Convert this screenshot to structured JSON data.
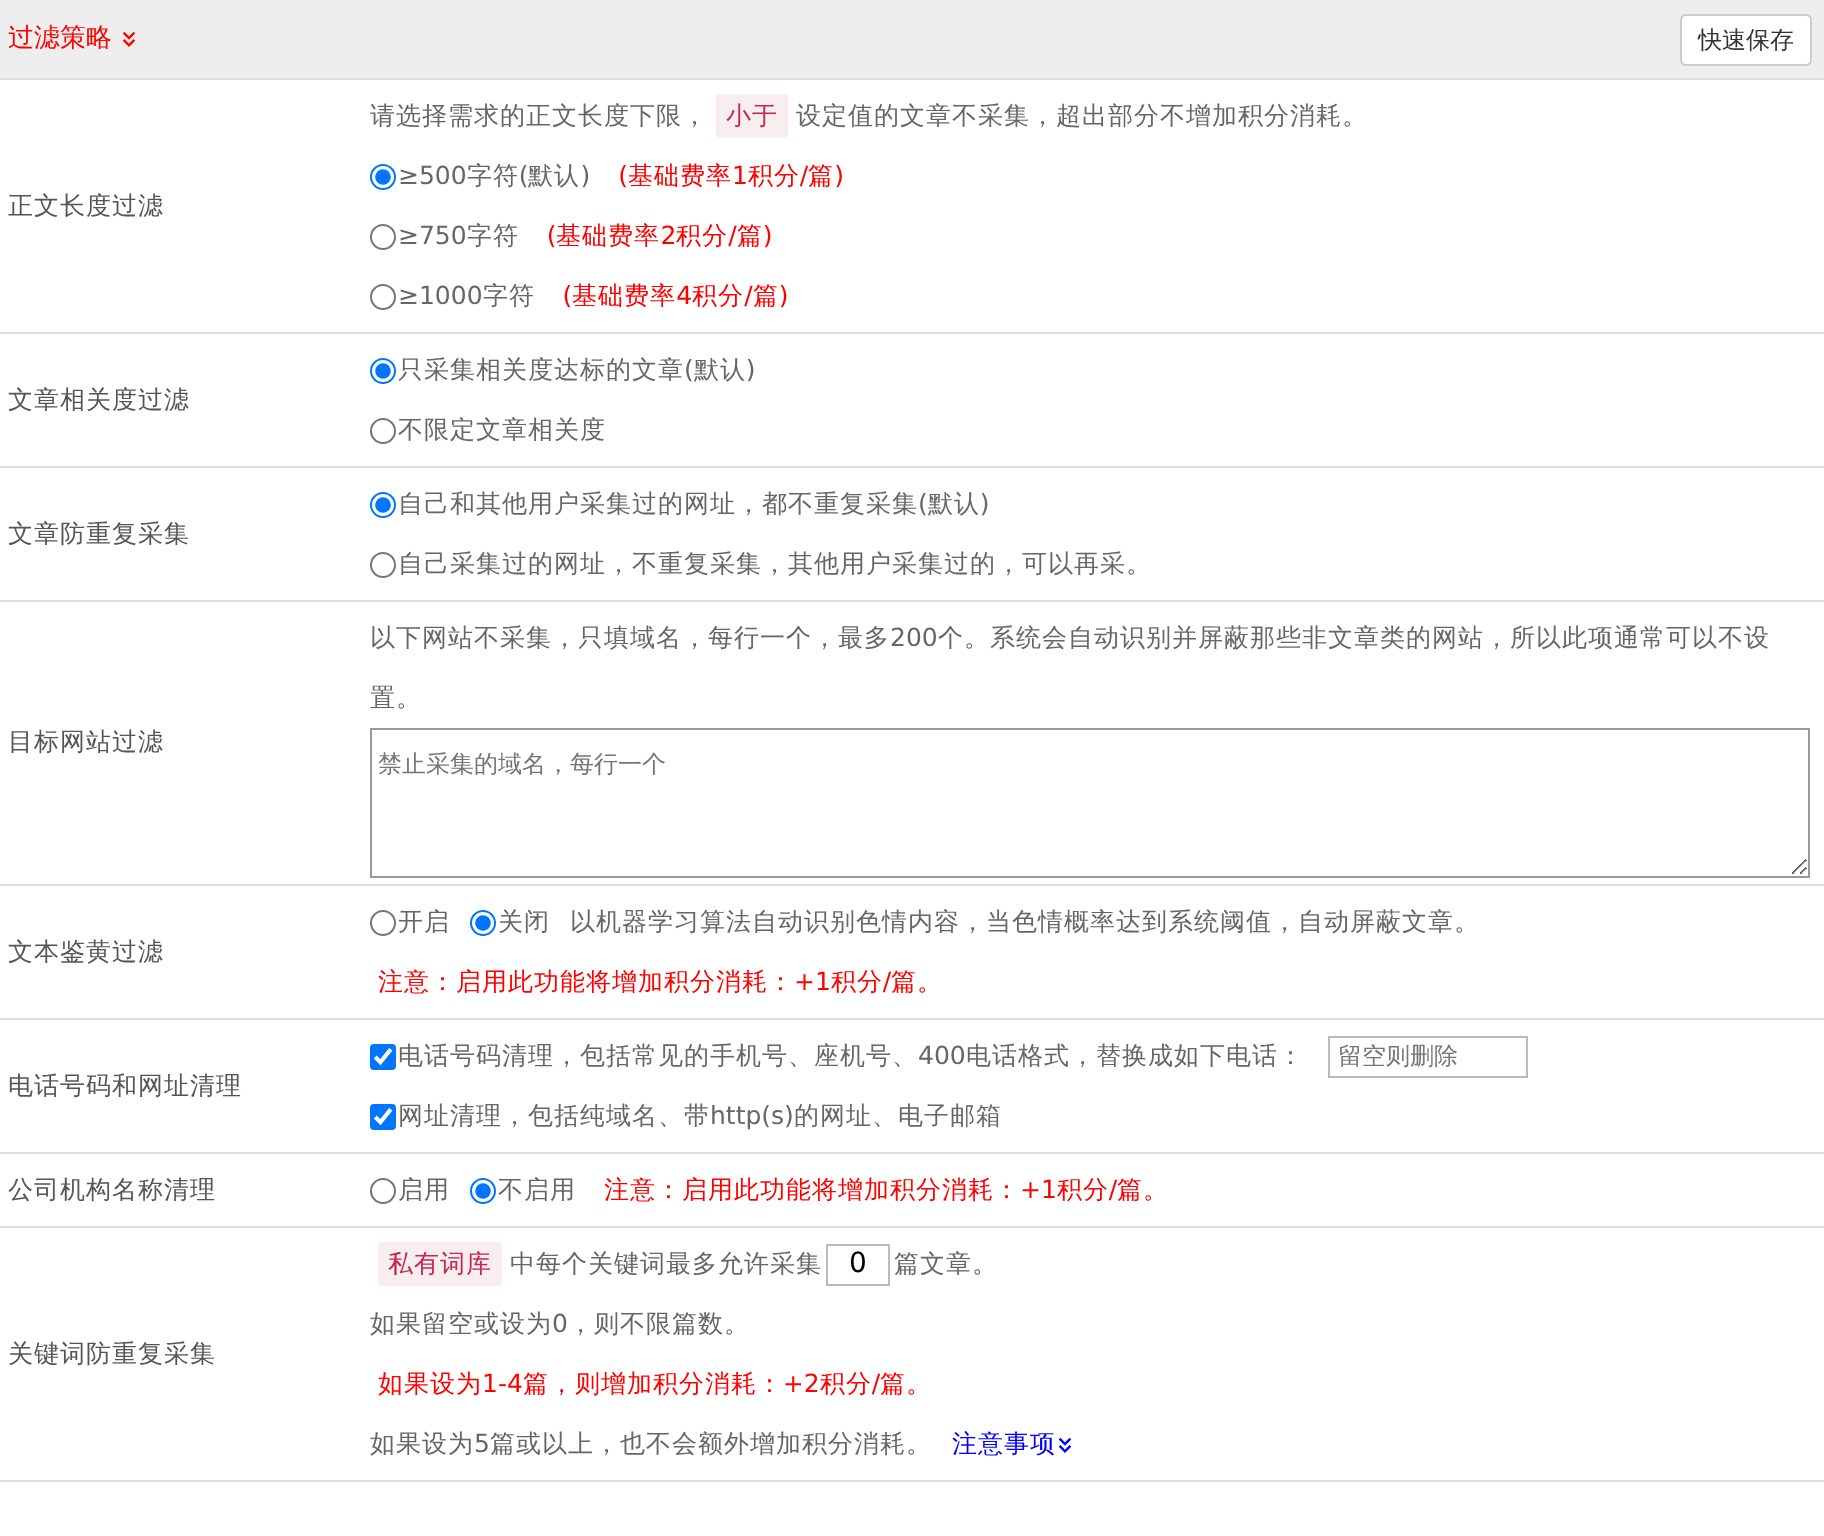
{
  "header": {
    "title": "过滤策略",
    "save_button": "快速保存"
  },
  "rows": [
    {
      "label": "正文长度过滤",
      "lines": [
        [
          {
            "kind": "text",
            "text": "请选择需求的正文长度下限，"
          },
          {
            "kind": "code",
            "text": "小于"
          },
          {
            "kind": "text",
            "text": "设定值的文章不采集，超出部分不增加积分消耗。"
          }
        ],
        [
          {
            "kind": "radio",
            "label": "≥500字符(默认)",
            "selected": true
          },
          {
            "kind": "note",
            "text": "(基础费率1积分/篇)"
          }
        ],
        [
          {
            "kind": "radio",
            "label": "≥750字符",
            "selected": false
          },
          {
            "kind": "note",
            "text": "(基础费率2积分/篇)"
          }
        ],
        [
          {
            "kind": "radio",
            "label": "≥1000字符",
            "selected": false
          },
          {
            "kind": "note",
            "text": "(基础费率4积分/篇)"
          }
        ]
      ]
    },
    {
      "label": "文章相关度过滤",
      "lines": [
        [
          {
            "kind": "radio",
            "label": "只采集相关度达标的文章(默认)",
            "selected": true
          }
        ],
        [
          {
            "kind": "radio",
            "label": "不限定文章相关度",
            "selected": false
          }
        ]
      ]
    },
    {
      "label": "文章防重复采集",
      "lines": [
        [
          {
            "kind": "radio",
            "label": "自己和其他用户采集过的网址，都不重复采集(默认)",
            "selected": true
          }
        ],
        [
          {
            "kind": "radio",
            "label": "自己采集过的网址，不重复采集，其他用户采集过的，可以再采。",
            "selected": false
          }
        ]
      ]
    },
    {
      "label": "目标网站过滤",
      "lines": [
        [
          {
            "kind": "text",
            "text": "以下网站不采集，只填域名，每行一个，最多200个。系统会自动识别并屏蔽那些非文章类的网站，所以此项通常可以不设置。"
          }
        ],
        [
          {
            "kind": "textarea",
            "placeholder": "禁止采集的域名，每行一个"
          }
        ]
      ]
    },
    {
      "label": "文本鉴黄过滤",
      "lines": [
        [
          {
            "kind": "radio",
            "label": "开启",
            "selected": false
          },
          {
            "kind": "radio",
            "label": "关闭",
            "selected": true
          },
          {
            "kind": "text",
            "text": "以机器学习算法自动识别色情内容，当色情概率达到系统阈值，自动屏蔽文章。"
          }
        ],
        [
          {
            "kind": "note",
            "text": "注意：启用此功能将增加积分消耗：+1积分/篇。"
          }
        ]
      ]
    },
    {
      "label": "电话号码和网址清理",
      "lines": [
        [
          {
            "kind": "checkbox",
            "label": "电话号码清理，包括常见的手机号、座机号、400电话格式，替换成如下电话：",
            "checked": true
          },
          {
            "kind": "input",
            "placeholder": "留空则删除"
          }
        ],
        [
          {
            "kind": "checkbox",
            "label": "网址清理，包括纯域名、带http(s)的网址、电子邮箱",
            "checked": true
          }
        ]
      ]
    },
    {
      "label": "公司机构名称清理",
      "lines": [
        [
          {
            "kind": "radio",
            "label": "启用",
            "selected": false
          },
          {
            "kind": "radio",
            "label": "不启用",
            "selected": true
          },
          {
            "kind": "note",
            "text": "注意：启用此功能将增加积分消耗：+1积分/篇。"
          }
        ]
      ]
    },
    {
      "label": "关键词防重复采集",
      "lines": [
        [
          {
            "kind": "code",
            "text": "私有词库"
          },
          {
            "kind": "text",
            "text": "中每个关键词最多允许采集"
          },
          {
            "kind": "input",
            "value": "0"
          },
          {
            "kind": "text",
            "text": "篇文章。"
          }
        ],
        [
          {
            "kind": "text",
            "text": "如果留空或设为0，则不限篇数。"
          }
        ],
        [
          {
            "kind": "note",
            "text": "如果设为1-4篇，则增加积分消耗：+2积分/篇。"
          }
        ],
        [
          {
            "kind": "text",
            "text": "如果设为5篇或以上，也不会额外增加积分消耗。"
          },
          {
            "kind": "link",
            "text": "注意事项"
          }
        ]
      ]
    }
  ]
}
